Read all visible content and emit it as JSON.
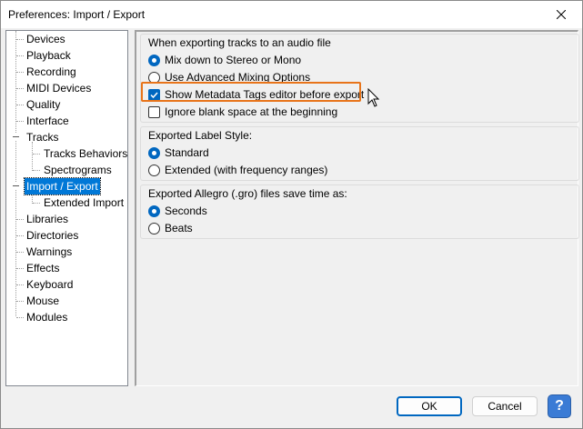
{
  "window": {
    "title": "Preferences: Import / Export"
  },
  "sidebar": {
    "items": [
      {
        "label": "Devices"
      },
      {
        "label": "Playback"
      },
      {
        "label": "Recording"
      },
      {
        "label": "MIDI Devices"
      },
      {
        "label": "Quality"
      },
      {
        "label": "Interface"
      },
      {
        "label": "Tracks"
      },
      {
        "label": "Tracks Behaviors"
      },
      {
        "label": "Spectrograms"
      },
      {
        "label": "Import / Export"
      },
      {
        "label": "Extended Import"
      },
      {
        "label": "Libraries"
      },
      {
        "label": "Directories"
      },
      {
        "label": "Warnings"
      },
      {
        "label": "Effects"
      },
      {
        "label": "Keyboard"
      },
      {
        "label": "Mouse"
      },
      {
        "label": "Modules"
      }
    ],
    "selected": "Import / Export"
  },
  "export_group": {
    "title": "When exporting tracks to an audio file",
    "mix_stereo": "Mix down to Stereo or Mono",
    "advanced_mixing": "Use Advanced Mixing Options",
    "show_metadata": "Show Metadata Tags editor before export",
    "ignore_blank": "Ignore blank space at the beginning"
  },
  "label_group": {
    "title": "Exported Label Style:",
    "standard": "Standard",
    "extended": "Extended (with frequency ranges)"
  },
  "allegro_group": {
    "title": "Exported Allegro (.gro) files save time as:",
    "seconds": "Seconds",
    "beats": "Beats"
  },
  "footer": {
    "ok_label": "OK",
    "cancel_label": "Cancel",
    "help_label": "?"
  },
  "colors": {
    "accent": "#0067c0",
    "selection": "#0078d7",
    "highlight": "#e8741a"
  }
}
